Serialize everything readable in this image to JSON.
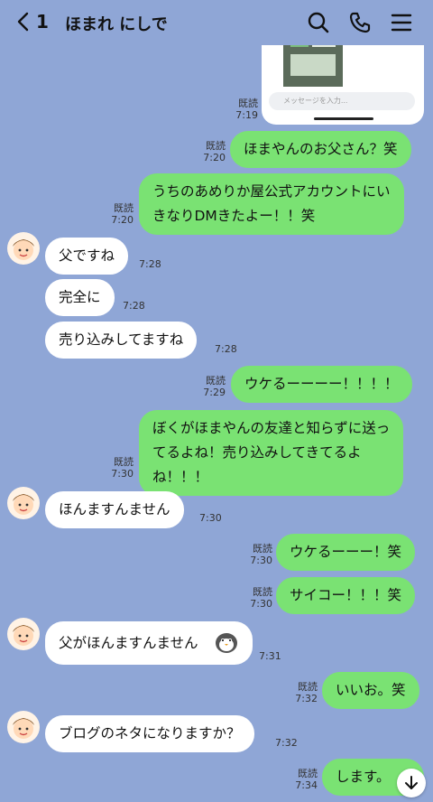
{
  "header": {
    "unread_count": "1",
    "title": "ほまれ にしで"
  },
  "screenshot_card": {
    "input_placeholder": "メッセージを入力..."
  },
  "messages": [
    {
      "side": "out",
      "text": "ほまやんのお父さん？笑",
      "read": "既読",
      "time": "7:20"
    },
    {
      "side": "out",
      "line1": "うちのあめりか屋公式アカウントにい",
      "line2": "きなりDMきたよー！！笑",
      "read": "既読",
      "time": "7:20"
    },
    {
      "side": "in",
      "text": "父ですね",
      "time": "7:28"
    },
    {
      "side": "in",
      "text": "完全に",
      "time": "7:28"
    },
    {
      "side": "in",
      "text": "売り込みしてますね",
      "time": "7:28"
    },
    {
      "side": "out",
      "text": "ウケるーーーー！！！！",
      "read": "既読",
      "time": "7:29"
    },
    {
      "side": "out",
      "line1": "ぼくがほまやんの友達と知らずに送っ",
      "line2": "てるよね！売り込みしてきてるよ",
      "line3": "ね！！！",
      "read": "既読",
      "time": "7:30"
    },
    {
      "side": "in",
      "text": "ほんますんません",
      "time": "7:30"
    },
    {
      "side": "out",
      "text": "ウケるーーー！笑",
      "read": "既読",
      "time": "7:30"
    },
    {
      "side": "out",
      "text": "サイコー！！！笑",
      "read": "既読",
      "time": "7:30"
    },
    {
      "side": "in",
      "text": "父がほんますんません",
      "time": "7:31"
    },
    {
      "side": "out",
      "text": "いいお。笑",
      "read": "既読",
      "time": "7:32"
    },
    {
      "side": "in",
      "text": "ブログのネタになりますか？",
      "time": "7:32"
    },
    {
      "side": "out",
      "text": "します。",
      "read": "既読",
      "time": "7:34"
    }
  ],
  "top_read": {
    "read": "既読",
    "time": "7:19"
  },
  "colors": {
    "background": "#8fa6d6",
    "outgoing": "#7ae273",
    "incoming": "#ffffff"
  },
  "icons": [
    "back-chevron-icon",
    "search-icon",
    "phone-icon",
    "menu-icon",
    "scroll-down-icon"
  ]
}
